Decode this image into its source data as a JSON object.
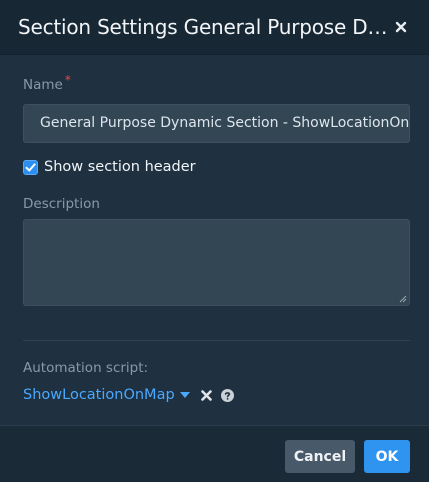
{
  "dialog": {
    "title": "Section Settings General Purpose Dynamic Section - ShowLocationOnMap",
    "close_icon": "close-icon"
  },
  "form": {
    "name_label": "Name",
    "name_required_marker": "*",
    "name_value": "General Purpose Dynamic Section - ShowLocationOnMap",
    "show_header_label": "Show section header",
    "show_header_checked": true,
    "description_label": "Description",
    "description_value": "",
    "automation_label": "Automation script:",
    "automation_value": "ShowLocationOnMap"
  },
  "buttons": {
    "cancel": "Cancel",
    "ok": "OK"
  },
  "colors": {
    "accent": "#2f93f0",
    "link": "#4aa8ff",
    "required": "#e04b4b",
    "background": "#1f3140"
  }
}
